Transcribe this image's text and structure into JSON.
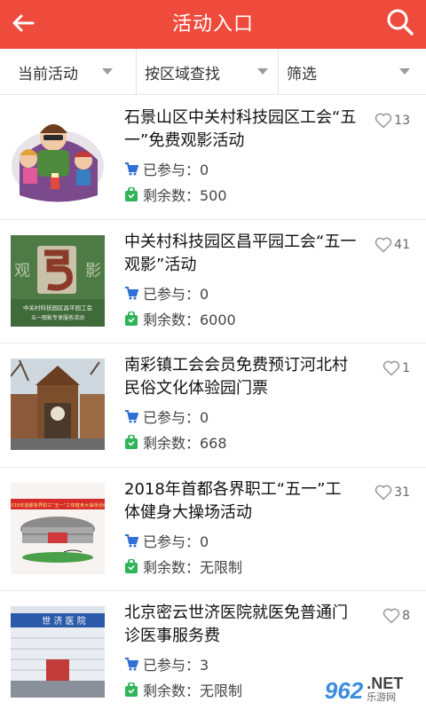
{
  "header": {
    "title": "活动入口",
    "back_icon": "back-arrow-icon",
    "search_icon": "search-icon",
    "color": "#ef4b3c"
  },
  "filters": [
    {
      "label": "当前活动"
    },
    {
      "label": "按区域查找"
    },
    {
      "label": "筛选"
    }
  ],
  "labels": {
    "joined_prefix": "已参与：",
    "remain_prefix": "剩余数："
  },
  "items": [
    {
      "title": "石景山区中关村科技园区工会“五一”免费观影活动",
      "likes": "13",
      "joined": "已参与：0",
      "remain": "剩余数：500"
    },
    {
      "title": "中关村科技园区昌平园工会“五一观影”活动",
      "likes": "41",
      "joined": "已参与：0",
      "remain": "剩余数：6000"
    },
    {
      "title": "南彩镇工会会员免费预订河北村民俗文化体验园门票",
      "likes": "1",
      "joined": "已参与：0",
      "remain": "剩余数：668"
    },
    {
      "title": "2018年首都各界职工“五一”工体健身大操场活动",
      "likes": "31",
      "joined": "已参与：0",
      "remain": "剩余数：无限制"
    },
    {
      "title": "北京密云世济医院就医免普通门诊医事服务费",
      "likes": "8",
      "joined": "已参与：3",
      "remain": "剩余数：无限制"
    }
  ],
  "thumb_text": {
    "item2_left": "观",
    "item2_right": "影",
    "item2_caption1": "中关村科技园区昌平园工会",
    "item2_caption2": "五一观影专享服务活动",
    "item4_banner": "2018年首都各界职工“五一”工体健身大操场活动",
    "item5_sign": "世 济 医 院"
  },
  "watermark": {
    "num": "962",
    "net": ".NET",
    "sub": "乐游网"
  },
  "colors": {
    "cart": "#2f6fd6",
    "bag": "#2fb45a",
    "heart": "#999999"
  }
}
